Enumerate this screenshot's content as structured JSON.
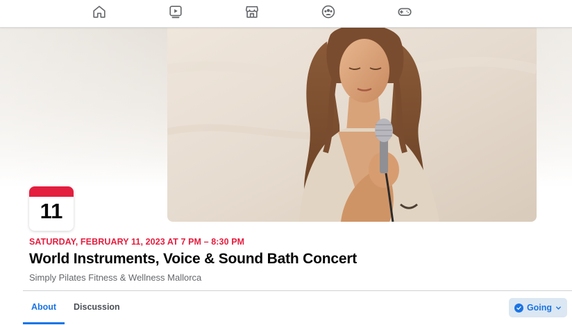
{
  "nav": {
    "icons": [
      "home-icon",
      "watch-icon",
      "marketplace-icon",
      "groups-icon",
      "gaming-icon"
    ]
  },
  "event": {
    "day": "11",
    "date_line": "SATURDAY, FEBRUARY 11, 2023 AT 7 PM – 8:30 PM",
    "title": "World Instruments, Voice & Sound Bath Concert",
    "host": "Simply Pilates Fitness & Wellness Mallorca"
  },
  "tabs": [
    {
      "label": "About",
      "active": true
    },
    {
      "label": "Discussion",
      "active": false
    }
  ],
  "rsvp": {
    "label": "Going",
    "icon": "check-circle-icon"
  },
  "colors": {
    "accent": "#1b74e4",
    "date_red": "#e41e3f",
    "going_bg": "#dbe7f2"
  }
}
